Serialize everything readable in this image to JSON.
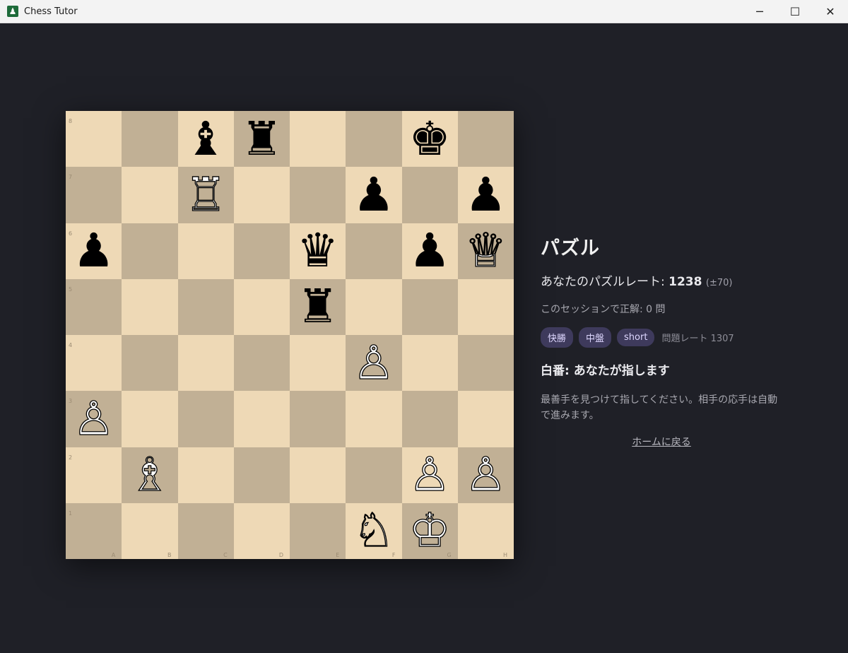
{
  "window": {
    "title": "Chess Tutor",
    "minimize_glyph": "─",
    "maximize_glyph": "☐",
    "close_glyph": "✕"
  },
  "board": {
    "ranks": [
      "8",
      "7",
      "6",
      "5",
      "4",
      "3",
      "2",
      "1"
    ],
    "files": [
      "A",
      "B",
      "C",
      "D",
      "E",
      "F",
      "G",
      "H"
    ],
    "light_color": "#eed9b6",
    "dark_color": "#c1b095",
    "pieces": [
      {
        "square": "c8",
        "color": "black",
        "type": "bishop",
        "glyph": "♝"
      },
      {
        "square": "d8",
        "color": "black",
        "type": "rook",
        "glyph": "♜"
      },
      {
        "square": "g8",
        "color": "black",
        "type": "king",
        "glyph": "♚"
      },
      {
        "square": "c7",
        "color": "white",
        "type": "rook",
        "glyph": "♖"
      },
      {
        "square": "f7",
        "color": "black",
        "type": "pawn",
        "glyph": "♟"
      },
      {
        "square": "h7",
        "color": "black",
        "type": "pawn",
        "glyph": "♟"
      },
      {
        "square": "a6",
        "color": "black",
        "type": "pawn",
        "glyph": "♟"
      },
      {
        "square": "e6",
        "color": "black",
        "type": "queen",
        "glyph": "♛"
      },
      {
        "square": "g6",
        "color": "black",
        "type": "pawn",
        "glyph": "♟"
      },
      {
        "square": "h6",
        "color": "white",
        "type": "queen",
        "glyph": "♕"
      },
      {
        "square": "e5",
        "color": "black",
        "type": "rook",
        "glyph": "♜"
      },
      {
        "square": "f4",
        "color": "white",
        "type": "pawn",
        "glyph": "♙"
      },
      {
        "square": "a3",
        "color": "white",
        "type": "pawn",
        "glyph": "♙"
      },
      {
        "square": "b2",
        "color": "white",
        "type": "bishop",
        "glyph": "♗"
      },
      {
        "square": "g2",
        "color": "white",
        "type": "pawn",
        "glyph": "♙"
      },
      {
        "square": "h2",
        "color": "white",
        "type": "pawn",
        "glyph": "♙"
      },
      {
        "square": "f1",
        "color": "white",
        "type": "knight",
        "glyph": "♘"
      },
      {
        "square": "g1",
        "color": "white",
        "type": "king",
        "glyph": "♔"
      }
    ]
  },
  "panel": {
    "title": "パズル",
    "rating_label": "あなたのパズルレート: ",
    "rating_value": "1238",
    "rating_deviation": "(±70)",
    "session_text": "このセッションで正解: 0 問",
    "tags": [
      "快勝",
      "中盤",
      "short"
    ],
    "puzzle_rating_text": "問題レート 1307",
    "turn_text": "白番: あなたが指します",
    "instructions": "最善手を見つけて指してください。相手の応手は自動で進みます。",
    "home_link": "ホームに戻る",
    "accent_tag_bg": "#3e3a5c"
  }
}
